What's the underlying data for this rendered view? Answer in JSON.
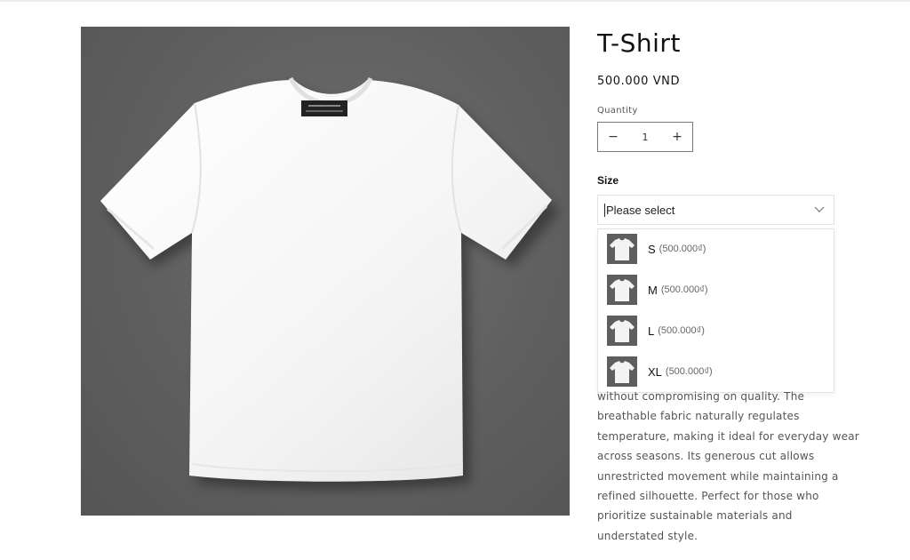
{
  "product": {
    "title": "T-Shirt",
    "price": "500.000 VND",
    "image_icon": "white-tshirt-photo"
  },
  "quantity": {
    "label": "Quantity",
    "value": "1",
    "decrease": "−",
    "increase": "+"
  },
  "size": {
    "label": "Size",
    "selected": "Please select",
    "options": [
      {
        "name": "S",
        "price": "(500.000₫)"
      },
      {
        "name": "M",
        "price": "(500.000₫)"
      },
      {
        "name": "L",
        "price": "(500.000₫)"
      },
      {
        "name": "XL",
        "price": "(500.000₫)"
      }
    ]
  },
  "description": {
    "lines": [
      "without compromising on quality. The",
      "breathable fabric naturally regulates",
      "temperature, making it ideal for everyday wear",
      "across seasons. Its generous cut allows",
      "unrestricted movement while maintaining a",
      "refined silhouette. Perfect for those who",
      "prioritize sustainable materials and",
      "understated style."
    ]
  },
  "colors": {
    "image_background": "#5f5f5f",
    "text": "#121212",
    "muted_text": "#555555"
  }
}
